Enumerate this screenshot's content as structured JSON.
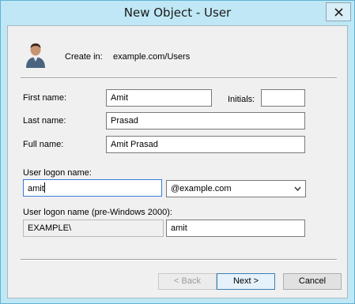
{
  "window": {
    "title": "New Object - User"
  },
  "header": {
    "create_in_label": "Create in:",
    "create_in_value": "example.com/Users"
  },
  "form": {
    "first_name_label": "First name:",
    "first_name_value": "Amit",
    "initials_label": "Initials:",
    "initials_value": "",
    "last_name_label": "Last name:",
    "last_name_value": "Prasad",
    "full_name_label": "Full name:",
    "full_name_value": "Amit Prasad",
    "logon_name_label": "User logon name:",
    "logon_name_value": "amit",
    "domain_value": "@example.com",
    "pre2000_label": "User logon name (pre-Windows 2000):",
    "pre2000_domain_value": "EXAMPLE\\",
    "pre2000_name_value": "amit"
  },
  "buttons": {
    "back": "< Back",
    "next": "Next >",
    "cancel": "Cancel"
  },
  "icons": {
    "close": "close-icon",
    "user": "user-avatar-icon",
    "dropdown": "chevron-down-icon"
  },
  "colors": {
    "titlebar": "#bfe7f5",
    "focus_border": "#3a7bd5"
  }
}
